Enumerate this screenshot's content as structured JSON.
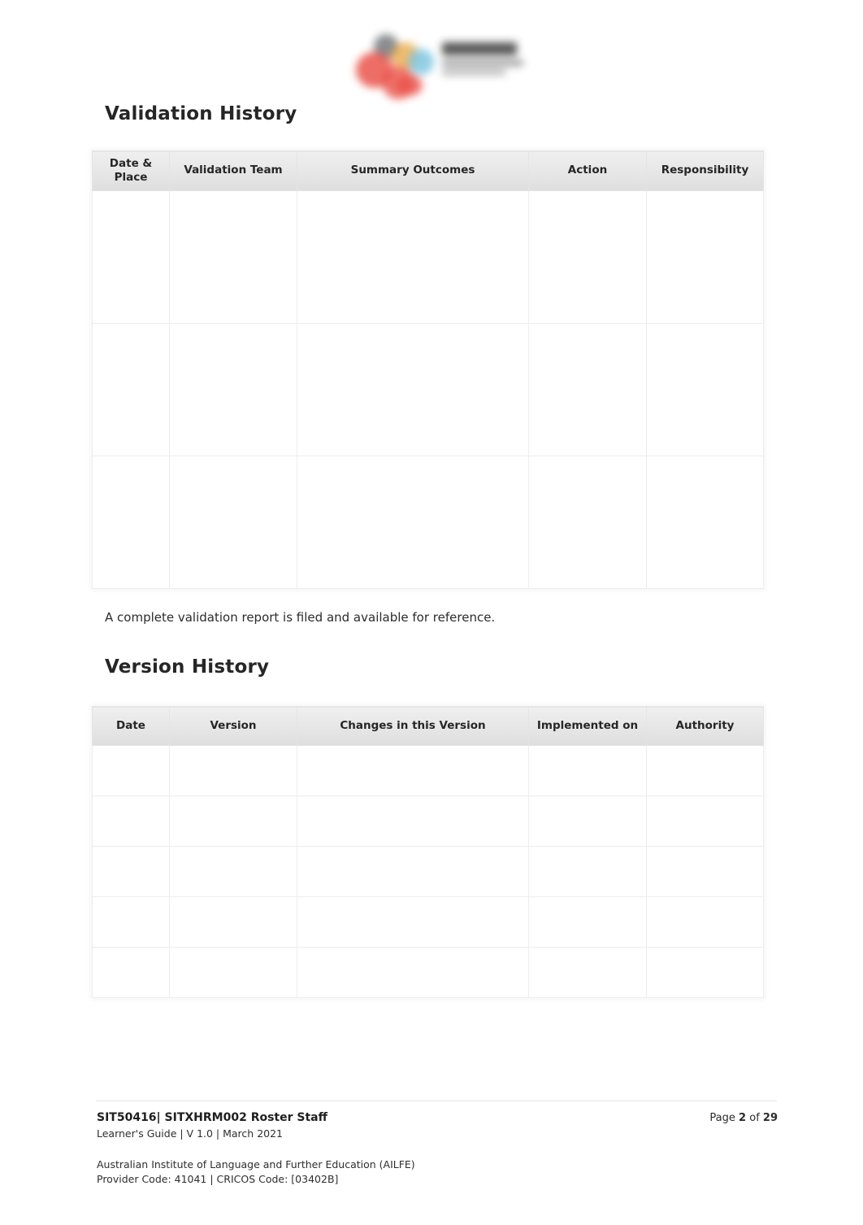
{
  "logo": {
    "name": "organisation-logo",
    "alt_text": ""
  },
  "sections": {
    "validation": {
      "heading": "Validation History",
      "note": "A complete validation report is filed and available for reference.",
      "table": {
        "columns": [
          "Date & Place",
          "Validation Team",
          "Summary Outcomes",
          "Action",
          "Responsibility"
        ],
        "rows": [
          [
            "",
            "",
            "",
            "",
            ""
          ],
          [
            "",
            "",
            "",
            "",
            ""
          ],
          [
            "",
            "",
            "",
            "",
            ""
          ]
        ]
      }
    },
    "version": {
      "heading": "Version History",
      "table": {
        "columns": [
          "Date",
          "Version",
          "Changes in this Version",
          "Implemented on",
          "Authority"
        ],
        "rows": [
          [
            "",
            "",
            "",
            "",
            ""
          ],
          [
            "",
            "",
            "",
            "",
            ""
          ],
          [
            "",
            "",
            "",
            "",
            ""
          ],
          [
            "",
            "",
            "",
            "",
            ""
          ],
          [
            "",
            "",
            "",
            "",
            ""
          ]
        ]
      }
    }
  },
  "footer": {
    "title": "SIT50416| SITXHRM002 Roster Staff",
    "subtitle": "Learner's Guide | V 1.0 | March 2021",
    "page_prefix": "Page",
    "page_number": "2",
    "page_of": "of",
    "page_total": "29",
    "org_line1": "Australian Institute of Language and Further Education (AILFE)",
    "org_line2": "Provider Code: 41041 | CRICOS Code: [03402B]"
  },
  "colors": {
    "text": "#222222",
    "header_fill": "#e6e6e6",
    "border": "#ededed",
    "logo_red": "#e8453c",
    "logo_orange": "#eba23a",
    "logo_blue": "#76c3de",
    "logo_grey": "#555a5e"
  }
}
